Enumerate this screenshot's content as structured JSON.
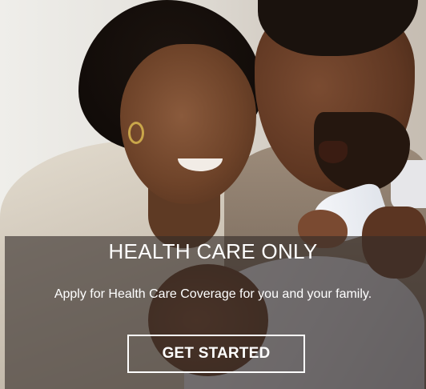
{
  "hero": {
    "headline": "HEALTH CARE ONLY",
    "subtext": "Apply for Health Care Coverage for you and your family.",
    "cta_label": "GET STARTED"
  },
  "colors": {
    "overlay": "#342c28",
    "text": "#ffffff",
    "button_border": "#ffffff"
  }
}
